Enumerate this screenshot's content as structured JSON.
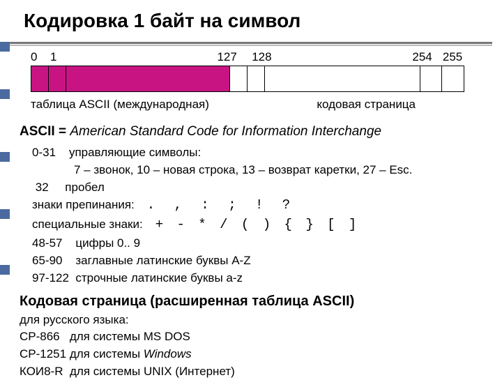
{
  "title": "Кодировка 1 байт на символ",
  "byte_numbers": {
    "n0": "0",
    "n1": "1",
    "n127": "127",
    "n128": "128",
    "n254": "254",
    "n255": "255"
  },
  "byte_labels": {
    "left": "таблица ASCII (международная)",
    "right": "кодовая страница"
  },
  "ascii_line": {
    "lhs": "ASCII = ",
    "rhs": "American Standard Code for Information Interchange"
  },
  "control": {
    "range": "0-31",
    "label": "управляющие символы:",
    "detail": "7 – звонок, 10 – новая строка, 13 – возврат каретки, 27 – Esc."
  },
  "space": {
    "range": "32",
    "label": "пробел"
  },
  "punct": {
    "label": "знаки препинания:",
    "chars": ".  ,  :  ;  !  ?"
  },
  "special": {
    "label": "специальные знаки:",
    "chars": "+  -  *  /   ( )   { }   [ ]"
  },
  "digits": {
    "range": "48-57",
    "label": "цифры 0.. 9"
  },
  "upper": {
    "range": "65-90",
    "label": "заглавные латинские буквы A-Z"
  },
  "lower": {
    "range": "97-122",
    "label": "строчные латинские буквы a-z"
  },
  "codepage": {
    "heading": "Кодовая страница (расширенная таблица ASCII)",
    "sub": "для русского языка:",
    "r1a": "CP-866",
    "r1b": "для системы MS DOS",
    "r2a": "CP-1251",
    "r2b_pre": "для системы ",
    "r2b_it": "Windows",
    "r3a": "КОИ8-R",
    "r3b": "для системы UNIX (Интернет)"
  }
}
